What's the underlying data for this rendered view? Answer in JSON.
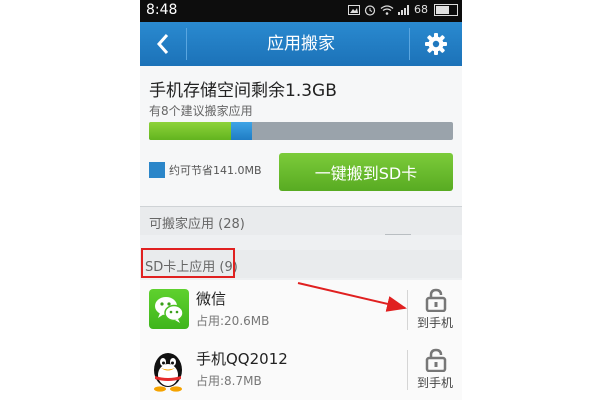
{
  "status_bar": {
    "time": "8:48",
    "battery": "68"
  },
  "header": {
    "title": "应用搬家"
  },
  "storage": {
    "headline": "手机存储空间剩余1.3GB",
    "suggestion": "有8个建议搬家应用",
    "saving_label": "约可节省141.0MB",
    "bar_used_fraction": 0.27,
    "bar_movable_fraction": 0.07,
    "one_key_button": "一键搬到SD卡"
  },
  "sections": {
    "movable": "可搬家应用 (28)",
    "on_sd": "SD卡上应用 (9)"
  },
  "apps": [
    {
      "name": "微信",
      "usage": "占用:20.6MB",
      "action": "到手机",
      "icon": "wechat-icon"
    },
    {
      "name": "手机QQ2012",
      "usage": "占用:8.7MB",
      "action": "到手机",
      "icon": "qq-icon"
    }
  ],
  "colors": {
    "header_blue": "#1c72b8",
    "button_green": "#62b41f",
    "highlight_red": "#e02020"
  }
}
